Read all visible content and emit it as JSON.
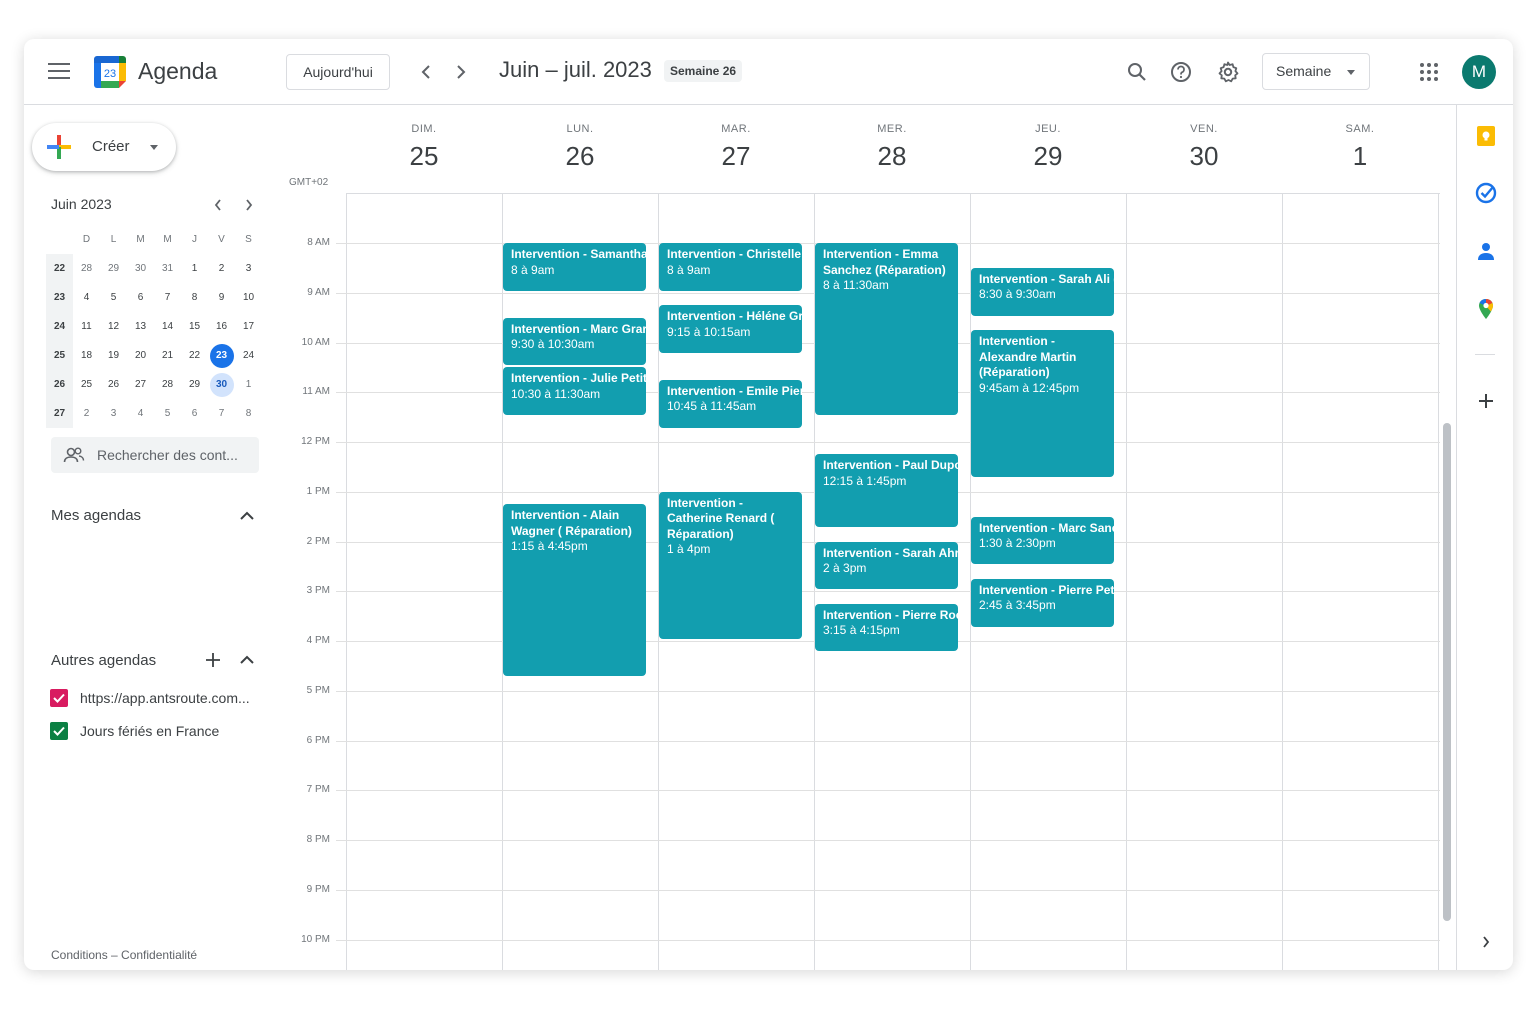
{
  "header": {
    "app_title": "Agenda",
    "logo_day": "23",
    "today_button": "Aujourd'hui",
    "range_title": "Juin – juil. 2023",
    "week_badge": "Semaine 26",
    "view_selector": "Semaine",
    "avatar_initial": "M"
  },
  "sidebar": {
    "create_label": "Créer",
    "mini_calendar": {
      "title": "Juin 2023",
      "weekday_headers": [
        "D",
        "L",
        "M",
        "M",
        "J",
        "V",
        "S"
      ],
      "weeks": [
        {
          "week": "22",
          "days": [
            "28",
            "29",
            "30",
            "31",
            "1",
            "2",
            "3"
          ]
        },
        {
          "week": "23",
          "days": [
            "4",
            "5",
            "6",
            "7",
            "8",
            "9",
            "10"
          ]
        },
        {
          "week": "24",
          "days": [
            "11",
            "12",
            "13",
            "14",
            "15",
            "16",
            "17"
          ]
        },
        {
          "week": "25",
          "days": [
            "18",
            "19",
            "20",
            "21",
            "22",
            "23",
            "24"
          ]
        },
        {
          "week": "26",
          "days": [
            "25",
            "26",
            "27",
            "28",
            "29",
            "30",
            "1"
          ]
        },
        {
          "week": "27",
          "days": [
            "2",
            "3",
            "4",
            "5",
            "6",
            "7",
            "8"
          ]
        }
      ],
      "today": "23",
      "selected": "30"
    },
    "people_search_placeholder": "Rechercher des cont...",
    "my_calendars_title": "Mes agendas",
    "other_calendars_title": "Autres agendas",
    "other_calendars": [
      {
        "label": "https://app.antsroute.com...",
        "color": "#d81b60",
        "checked": true
      },
      {
        "label": "Jours fériés en France",
        "color": "#0b8043",
        "checked": true
      }
    ],
    "footer": "Conditions – Confidentialité"
  },
  "grid": {
    "timezone": "GMT+02",
    "days": [
      {
        "dow": "DIM.",
        "num": "25"
      },
      {
        "dow": "LUN.",
        "num": "26"
      },
      {
        "dow": "MAR.",
        "num": "27"
      },
      {
        "dow": "MER.",
        "num": "28"
      },
      {
        "dow": "JEU.",
        "num": "29"
      },
      {
        "dow": "VEN.",
        "num": "30"
      },
      {
        "dow": "SAM.",
        "num": "1"
      }
    ],
    "hour_labels": [
      "8 AM",
      "9 AM",
      "10 AM",
      "11 AM",
      "12 PM",
      "1 PM",
      "2 PM",
      "3 PM",
      "4 PM",
      "5 PM",
      "6 PM",
      "7 PM",
      "8 PM",
      "9 PM",
      "10 PM"
    ],
    "event_color": "#129eaf",
    "events": [
      {
        "day": 1,
        "start": 8.0,
        "end": 9.0,
        "title": "Intervention - Samantha",
        "time": "8 à 9am"
      },
      {
        "day": 1,
        "start": 9.5,
        "end": 10.5,
        "title": "Intervention - Marc Grar",
        "time": "9:30 à 10:30am"
      },
      {
        "day": 1,
        "start": 10.5,
        "end": 11.5,
        "title": "Intervention - Julie Petit",
        "time": "10:30 à 11:30am"
      },
      {
        "day": 1,
        "start": 13.25,
        "end": 16.75,
        "title": "Intervention - Alain Wagner ( Réparation)",
        "time": "1:15 à 4:45pm"
      },
      {
        "day": 2,
        "start": 8.0,
        "end": 9.0,
        "title": "Intervention - Christelle",
        "time": "8 à 9am"
      },
      {
        "day": 2,
        "start": 9.25,
        "end": 10.25,
        "title": "Intervention - Héléne Gr",
        "time": "9:15 à 10:15am"
      },
      {
        "day": 2,
        "start": 10.75,
        "end": 11.75,
        "title": "Intervention - Emile Pier",
        "time": "10:45 à 11:45am"
      },
      {
        "day": 2,
        "start": 13.0,
        "end": 16.0,
        "title": "Intervention - Catherine Renard ( Réparation)",
        "time": "1 à 4pm"
      },
      {
        "day": 3,
        "start": 8.0,
        "end": 11.5,
        "title": "Intervention - Emma Sanchez (Réparation)",
        "time": "8 à 11:30am"
      },
      {
        "day": 3,
        "start": 12.25,
        "end": 13.75,
        "title": "Intervention - Paul Dupont (Installation)",
        "time": "12:15 à 1:45pm"
      },
      {
        "day": 3,
        "start": 14.0,
        "end": 15.0,
        "title": "Intervention - Sarah Ahr",
        "time": "2 à 3pm"
      },
      {
        "day": 3,
        "start": 15.25,
        "end": 16.25,
        "title": "Intervention - Pierre Roc",
        "time": "3:15 à 4:15pm"
      },
      {
        "day": 4,
        "start": 8.5,
        "end": 9.5,
        "title": "Intervention - Sarah Ali (",
        "time": "8:30 à 9:30am"
      },
      {
        "day": 4,
        "start": 9.75,
        "end": 12.75,
        "title": "Intervention - Alexandre Martin (Réparation)",
        "time": "9:45am à 12:45pm"
      },
      {
        "day": 4,
        "start": 13.5,
        "end": 14.5,
        "title": "Intervention - Marc Sanc",
        "time": "1:30 à 2:30pm"
      },
      {
        "day": 4,
        "start": 14.75,
        "end": 15.75,
        "title": "Intervention - Pierre Pet",
        "time": "2:45 à 3:45pm"
      }
    ]
  },
  "icons": {
    "menu": "hamburger-icon",
    "search": "search-icon",
    "help": "help-icon",
    "settings": "gear-icon",
    "apps": "apps-grid-icon",
    "keep": "keep-icon",
    "tasks": "tasks-icon",
    "contacts": "contacts-icon",
    "maps": "maps-icon",
    "add": "plus-icon",
    "expand": "chevron-right-icon"
  }
}
